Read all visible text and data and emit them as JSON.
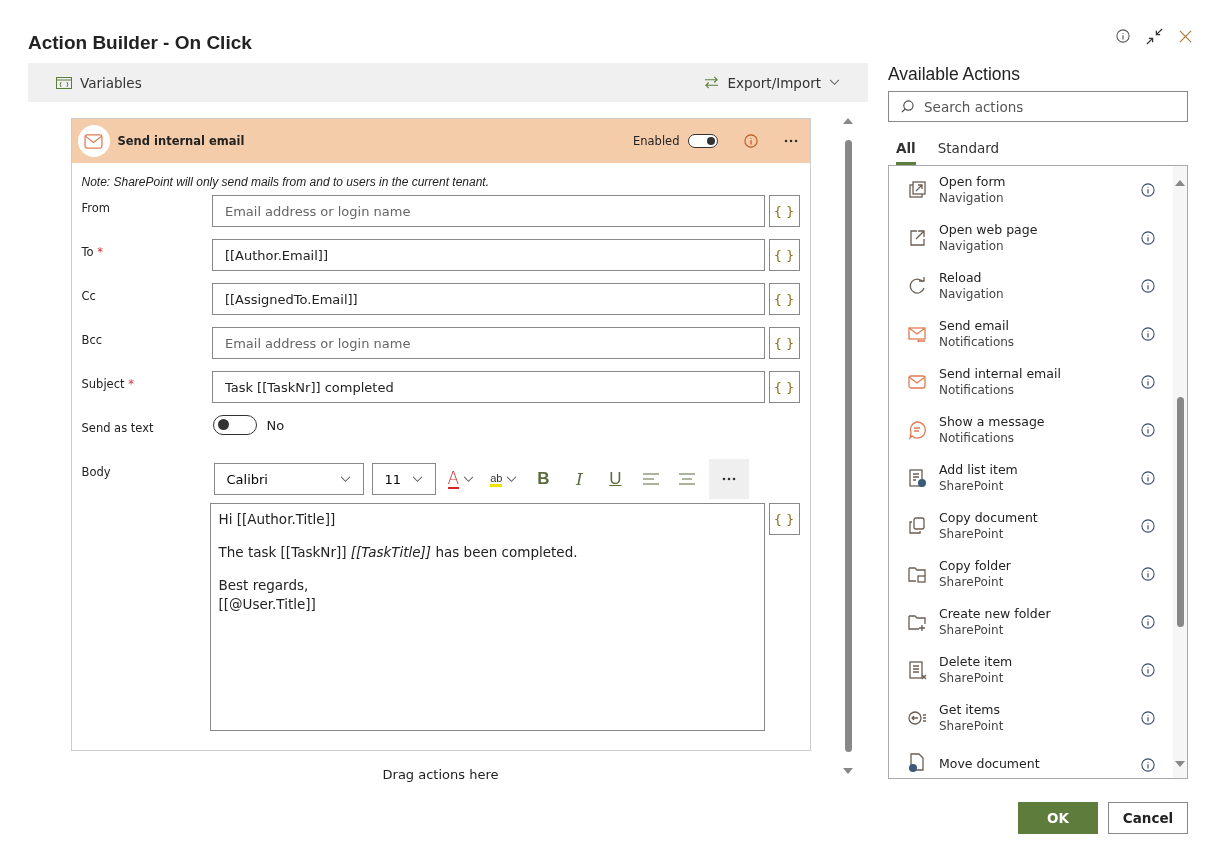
{
  "window": {
    "title": "Action Builder - On Click"
  },
  "toolbar": {
    "variables": "Variables",
    "export_import": "Export/Import"
  },
  "action": {
    "title": "Send internal email",
    "enabled_label": "Enabled",
    "enabled": true,
    "note": "Note: SharePoint will only send mails from and to users in the current tenant.",
    "fields": [
      {
        "label": "From",
        "placeholder": "Email address or login name",
        "braces": "{ }"
      },
      {
        "label": "To",
        "required_mark": "*",
        "value": "[[Author.Email]]",
        "braces": "{ }"
      },
      {
        "label": "Cc",
        "value": "[[AssignedTo.Email]]",
        "braces": "{ }"
      },
      {
        "label": "Bcc",
        "placeholder": "Email address or login name",
        "braces": "{ }"
      },
      {
        "label": "Subject",
        "required_mark": "*",
        "value": "Task [[TaskNr]] completed",
        "braces": "{ }"
      }
    ],
    "send_as_text": {
      "label": "Send as text",
      "on": false,
      "state_text": "No"
    },
    "body": {
      "label": "Body",
      "font": "Calibri",
      "size": "11",
      "tools": [
        {
          "kind": "font-color",
          "label": "A"
        },
        {
          "kind": "highlight",
          "label": "ab"
        },
        {
          "kind": "bold",
          "label": "B"
        },
        {
          "kind": "italic",
          "label": "I"
        },
        {
          "kind": "underline",
          "label": "U"
        },
        {
          "kind": "align-left"
        },
        {
          "kind": "align-center"
        },
        {
          "kind": "more"
        }
      ],
      "paragraphs": [
        "Hi [[Author.Title]]",
        "The task [[TaskNr]] *[[TaskTitle]]* has been completed.",
        "Best regards,\n[[@User.Title]]"
      ],
      "braces": "{ }"
    }
  },
  "drop_hint": "Drag actions here",
  "available": {
    "title": "Available Actions",
    "search_placeholder": "Search actions",
    "tabs": [
      {
        "label": "All",
        "selected": true
      },
      {
        "label": "Standard",
        "selected": false
      }
    ],
    "items": [
      {
        "name": "Open form",
        "category": "Navigation"
      },
      {
        "name": "Open web page",
        "category": "Navigation"
      },
      {
        "name": "Reload",
        "category": "Navigation"
      },
      {
        "name": "Send email",
        "category": "Notifications"
      },
      {
        "name": "Send internal email",
        "category": "Notifications"
      },
      {
        "name": "Show a message",
        "category": "Notifications"
      },
      {
        "name": "Add list item",
        "category": "SharePoint"
      },
      {
        "name": "Copy document",
        "category": "SharePoint"
      },
      {
        "name": "Copy folder",
        "category": "SharePoint"
      },
      {
        "name": "Create new folder",
        "category": "SharePoint"
      },
      {
        "name": "Delete item",
        "category": "SharePoint"
      },
      {
        "name": "Get items",
        "category": "SharePoint"
      },
      {
        "name": "Move document"
      }
    ]
  },
  "buttons": [
    {
      "label": "OK",
      "kind": "primary"
    },
    {
      "label": "Cancel",
      "kind": "secondary"
    }
  ]
}
